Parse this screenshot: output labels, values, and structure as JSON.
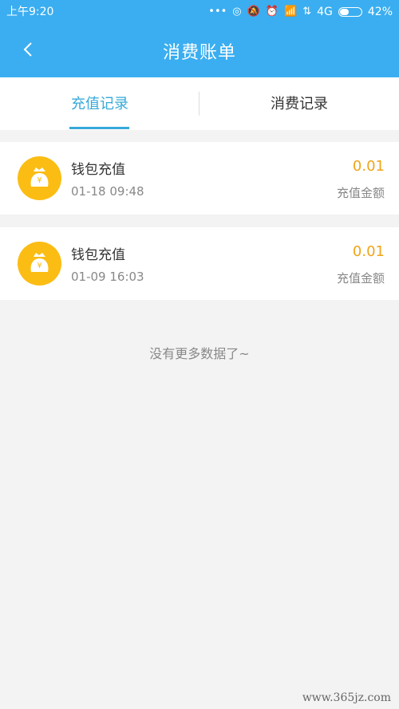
{
  "status_bar": {
    "time": "上午9:20",
    "network": "4G",
    "battery": "42%",
    "icons": [
      "more-dots-icon",
      "signal-icon",
      "mute-icon",
      "alarm-icon",
      "hd-signal-icon",
      "data-arrows-icon",
      "battery-icon"
    ]
  },
  "header": {
    "title": "消费账单",
    "back_icon": "chevron-left-icon"
  },
  "tabs": [
    {
      "label": "充值记录",
      "active": true
    },
    {
      "label": "消费记录",
      "active": false
    }
  ],
  "records": [
    {
      "name": "钱包充值",
      "time": "01-18 09:48",
      "amount": "0.01",
      "amount_label": "充值金额",
      "icon": "money-bag-icon"
    },
    {
      "name": "钱包充值",
      "time": "01-09 16:03",
      "amount": "0.01",
      "amount_label": "充值金额",
      "icon": "money-bag-icon"
    }
  ],
  "footer": {
    "no_more": "没有更多数据了~"
  },
  "watermark": "www.365jz.com",
  "colors": {
    "header_bg": "#3aaef0",
    "accent": "#37a9d9",
    "amount": "#f0a419",
    "icon_bg": "#fbbd14"
  }
}
